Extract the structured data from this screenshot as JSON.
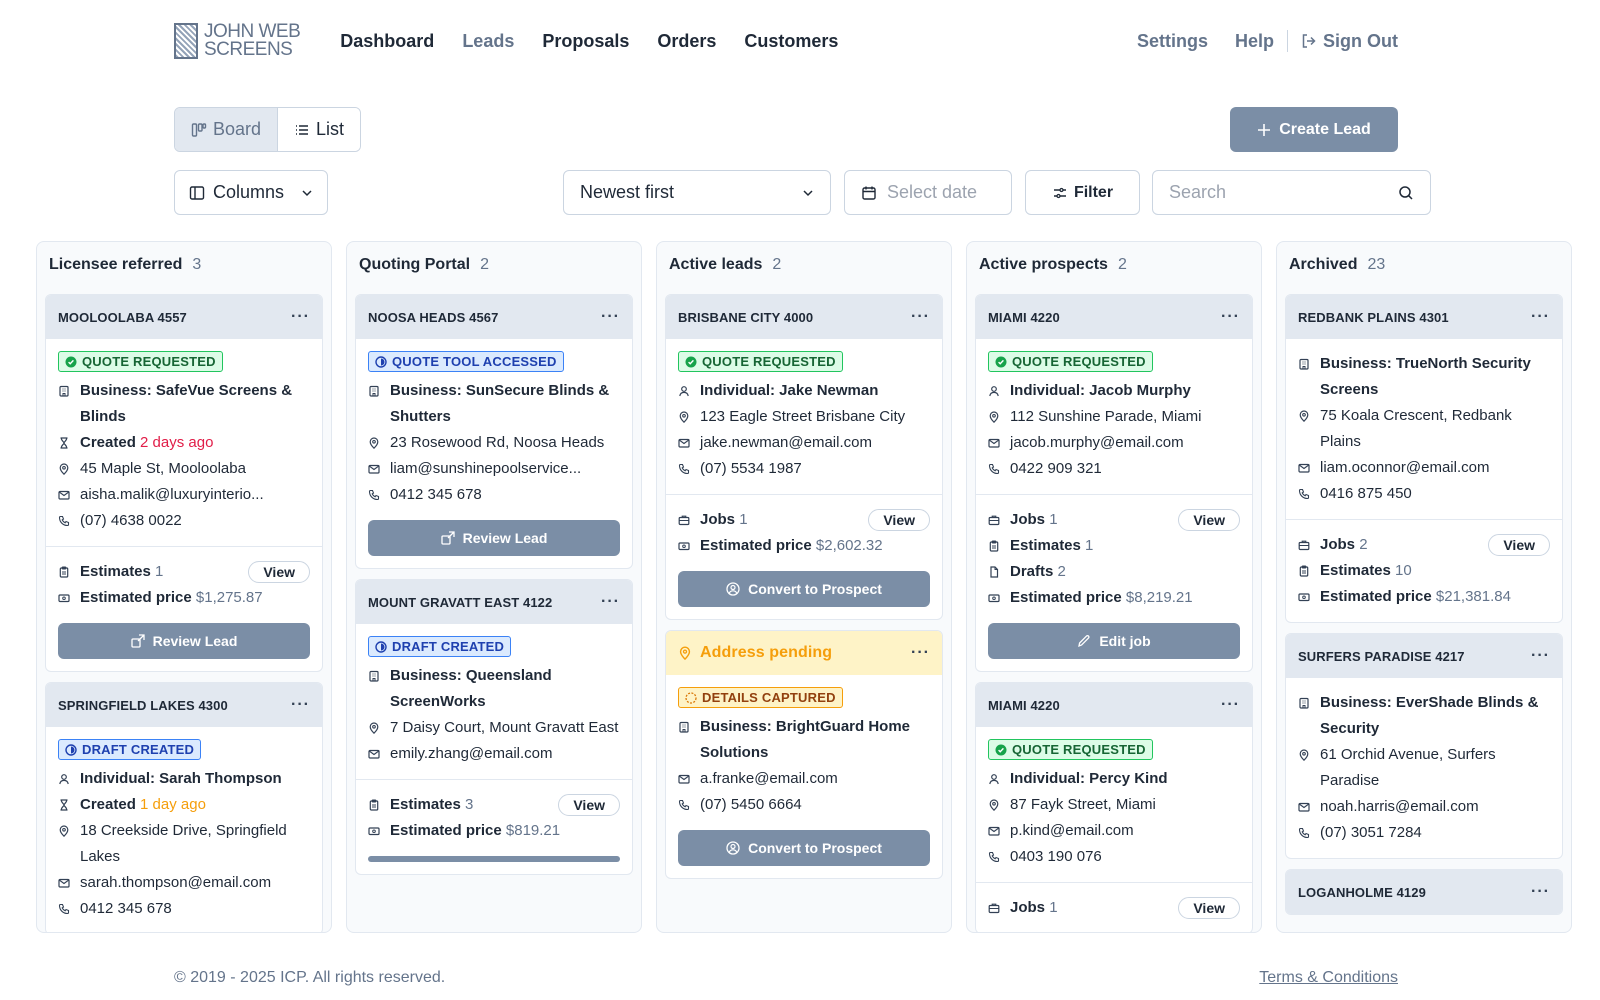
{
  "nav": {
    "logo_line1": "JOHN WEB",
    "logo_line2": "SCREENS",
    "links": [
      "Dashboard",
      "Leads",
      "Proposals",
      "Orders",
      "Customers"
    ],
    "active": "Leads",
    "settings": "Settings",
    "help": "Help",
    "signout": "Sign Out"
  },
  "toolbar": {
    "board": "Board",
    "list": "List",
    "create": "Create Lead",
    "columns": "Columns",
    "sort": "Newest first",
    "date_placeholder": "Select date",
    "filter": "Filter",
    "search_placeholder": "Search"
  },
  "colors": {
    "accent": "#7b8ea6",
    "green": "#22c55e",
    "blue": "#3b82f6",
    "amber": "#f59e0b",
    "red": "#e11d48"
  },
  "board": {
    "columns": [
      {
        "title": "Licensee referred",
        "count": "3",
        "cards": [
          {
            "header": "MOOLOOLABA 4557",
            "badge": "QUOTE REQUESTED",
            "business": "Business: SafeVue Screens & Blinds",
            "created_label": "Created",
            "created_value": "2 days ago",
            "address": "45 Maple St, Mooloolaba",
            "email": "aisha.malik@luxuryinterio...",
            "phone": "(07) 4638 0022",
            "estimates_label": "Estimates",
            "estimates_value": "1",
            "price_label": "Estimated price",
            "price_value": "$1,275.87",
            "view": "View",
            "action": "Review Lead"
          },
          {
            "header": "SPRINGFIELD LAKES 4300",
            "badge": "DRAFT CREATED",
            "individual": "Individual: Sarah Thompson",
            "created_label": "Created",
            "created_value": "1 day ago",
            "address": "18 Creekside Drive, Springfield Lakes",
            "email": "sarah.thompson@email.com",
            "phone": "0412 345 678"
          }
        ]
      },
      {
        "title": "Quoting Portal",
        "count": "2",
        "cards": [
          {
            "header": "NOOSA HEADS 4567",
            "badge": "QUOTE TOOL ACCESSED",
            "business": "Business: SunSecure Blinds & Shutters",
            "address": "23 Rosewood Rd, Noosa Heads",
            "email": "liam@sunshinepoolservice...",
            "phone": "0412 345 678",
            "action": "Review Lead"
          },
          {
            "header": "MOUNT GRAVATT EAST 4122",
            "badge": "DRAFT CREATED",
            "business": "Business: Queensland ScreenWorks",
            "address": "7 Daisy Court, Mount Gravatt East",
            "email": "emily.zhang@email.com",
            "estimates_label": "Estimates",
            "estimates_value": "3",
            "price_label": "Estimated price",
            "price_value": "$819.21",
            "view": "View"
          }
        ]
      },
      {
        "title": "Active leads",
        "count": "2",
        "cards": [
          {
            "header": "BRISBANE CITY 4000",
            "badge": "QUOTE REQUESTED",
            "individual": "Individual: Jake Newman",
            "address": "123 Eagle Street Brisbane City",
            "email": "jake.newman@email.com",
            "phone": "(07) 5534 1987",
            "jobs_label": "Jobs",
            "jobs_value": "1",
            "price_label": "Estimated price",
            "price_value": "$2,602.32",
            "view": "View",
            "action": "Convert to Prospect"
          },
          {
            "header": "Address pending",
            "badge": "DETAILS CAPTURED",
            "business": "Business: BrightGuard Home Solutions",
            "email": "a.franke@email.com",
            "phone": "(07) 5450 6664",
            "action": "Convert to Prospect"
          }
        ]
      },
      {
        "title": "Active prospects",
        "count": "2",
        "cards": [
          {
            "header": "MIAMI 4220",
            "badge": "QUOTE REQUESTED",
            "individual": "Individual: Jacob Murphy",
            "address": "112 Sunshine Parade, Miami",
            "email": "jacob.murphy@email.com",
            "phone": "0422 909 321",
            "jobs_label": "Jobs",
            "jobs_value": "1",
            "estimates_label": "Estimates",
            "estimates_value": "1",
            "drafts_label": "Drafts",
            "drafts_value": "2",
            "price_label": "Estimated price",
            "price_value": "$8,219.21",
            "view": "View",
            "action": "Edit job"
          },
          {
            "header": "MIAMI 4220",
            "badge": "QUOTE REQUESTED",
            "individual": "Individual: Percy Kind",
            "address": "87 Fayk Street, Miami",
            "email": "p.kind@email.com",
            "phone": "0403 190 076",
            "jobs_label": "Jobs",
            "jobs_value": "1",
            "view": "View"
          }
        ]
      },
      {
        "title": "Archived",
        "count": "23",
        "cards": [
          {
            "header": "REDBANK PLAINS 4301",
            "business": "Business: TrueNorth Security Screens",
            "address": "75 Koala Crescent, Redbank Plains",
            "email": "liam.oconnor@email.com",
            "phone": "0416 875 450",
            "jobs_label": "Jobs",
            "jobs_value": "2",
            "estimates_label": "Estimates",
            "estimates_value": "10",
            "price_label": "Estimated price",
            "price_value": "$21,381.84",
            "view": "View"
          },
          {
            "header": "SURFERS PARADISE 4217",
            "business": "Business: EverShade Blinds & Security",
            "address": "61 Orchid Avenue, Surfers Paradise",
            "email": "noah.harris@email.com",
            "phone": "(07) 3051 7284"
          },
          {
            "header": "LOGANHOLME 4129"
          }
        ]
      }
    ]
  },
  "footer": {
    "copyright": "© 2019 - 2025 ICP. All rights reserved.",
    "terms": "Terms & Conditions"
  }
}
